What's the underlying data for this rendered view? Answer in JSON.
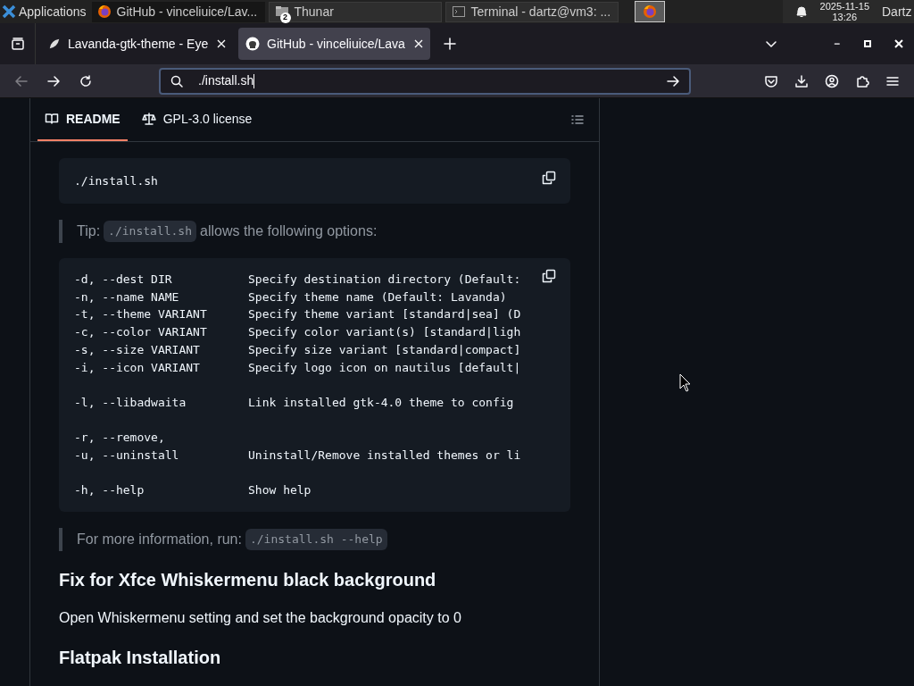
{
  "taskbar": {
    "menu": "Applications",
    "windows": [
      {
        "title": "GitHub - vinceliuice/Lav...",
        "selected": true
      },
      {
        "title": "Thunar",
        "badge": "2",
        "selected": false
      },
      {
        "title": "Terminal - dartz@vm3: ...",
        "selected": false
      }
    ],
    "date": "2025-11-15",
    "time": "13:26",
    "user": "Dartz"
  },
  "browser_tabs": [
    {
      "title": "Lavanda-gtk-theme - Eye",
      "selected": false
    },
    {
      "title": "GitHub - vinceliuice/Lava",
      "selected": true
    }
  ],
  "address_bar": {
    "value": "./install.sh"
  },
  "readme_tabs": [
    {
      "label": "README",
      "selected": true
    },
    {
      "label": "GPL-3.0 license",
      "selected": false
    }
  ],
  "content": [
    {
      "kind": "code",
      "text": "./install.sh"
    },
    {
      "kind": "quote",
      "before": "Tip:",
      "code": "./install.sh",
      "after": "allows the following options:"
    },
    {
      "kind": "options",
      "groups": [
        [
          {
            "option": "-d, --dest DIR",
            "description": "Specify destination directory (Default:"
          },
          {
            "option": "-n, --name NAME",
            "description": "Specify theme name (Default: Lavanda)"
          },
          {
            "option": "-t, --theme VARIANT",
            "description": "Specify theme variant [standard|sea] (D"
          },
          {
            "option": "-c, --color VARIANT",
            "description": "Specify color variant(s) [standard|ligh"
          },
          {
            "option": "-s, --size VARIANT",
            "description": "Specify size variant [standard|compact]"
          },
          {
            "option": "-i, --icon VARIANT",
            "description": "Specify logo icon on nautilus [default|"
          }
        ],
        [
          {
            "option": "-l, --libadwaita",
            "description": "Link installed gtk-4.0 theme to config"
          }
        ],
        [
          {
            "option": "-r, --remove,"
          },
          {
            "option": "-u, --uninstall",
            "description": "Uninstall/Remove installed themes or li"
          }
        ],
        [
          {
            "option": "-h, --help",
            "description": "Show help"
          }
        ]
      ]
    },
    {
      "kind": "quote",
      "before": "For more information, run:",
      "code": "./install.sh --help"
    },
    {
      "kind": "heading",
      "text": "Fix for Xfce Whiskermenu black background"
    },
    {
      "kind": "paragraph",
      "text": "Open Whiskermenu setting and set the background opacity to 0"
    },
    {
      "kind": "heading",
      "text": "Flatpak Installation"
    }
  ]
}
